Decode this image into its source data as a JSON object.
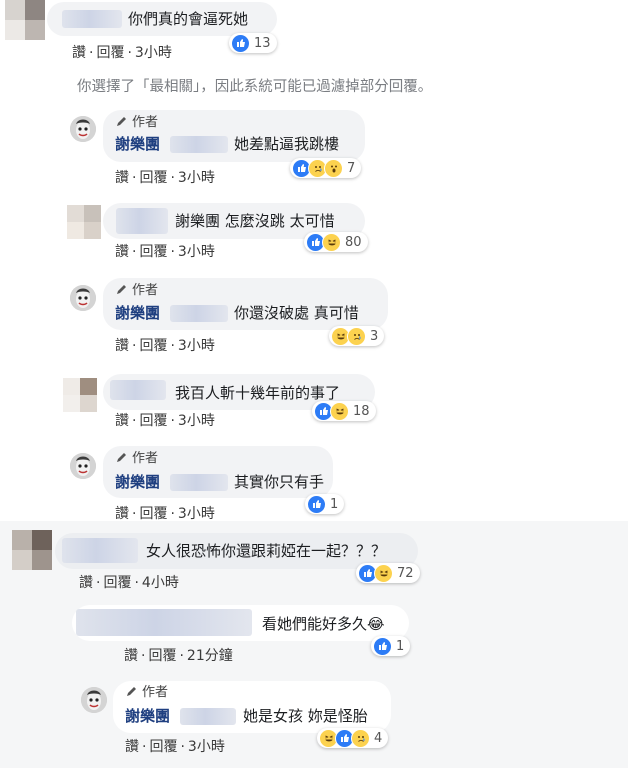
{
  "actions": {
    "like": "讚",
    "reply": "回覆",
    "separator": "·"
  },
  "author_badge": "作者",
  "notice": "你選擇了「最相關」，因此系統可能已過濾掉部分回覆。",
  "colors": {
    "like_blue": "#2d7cf6",
    "emoji_yellow": "#fcd24f",
    "name_blue": "#1f3f80"
  },
  "comments": [
    {
      "text": "你們真的會逼死她",
      "time": "3小時",
      "reactions": [
        "like"
      ],
      "count": "13"
    },
    {
      "author": true,
      "name": "謝樂團",
      "text": "她差點逼我跳樓",
      "time": "3小時",
      "reactions": [
        "like",
        "sad",
        "wow"
      ],
      "count": "7"
    },
    {
      "name": "謝樂團",
      "text": "怎麼沒跳 太可惜",
      "time": "3小時",
      "reactions": [
        "like",
        "haha"
      ],
      "count": "80"
    },
    {
      "author": true,
      "name": "謝樂團",
      "text": "你還沒破處 真可惜",
      "time": "3小時",
      "reactions": [
        "haha",
        "sad"
      ],
      "count": "3"
    },
    {
      "text": "我百人斬十幾年前的事了",
      "time": "3小時",
      "reactions": [
        "like",
        "haha"
      ],
      "count": "18"
    },
    {
      "author": true,
      "name": "謝樂團",
      "text": "其實你只有手",
      "time": "3小時",
      "reactions": [
        "like"
      ],
      "count": "1"
    },
    {
      "text": "女人很恐怖你還跟莉婭在一起？？？",
      "time": "4小時",
      "reactions": [
        "like",
        "haha"
      ],
      "count": "72"
    },
    {
      "text": "看她們能好多久",
      "emoji": "😂",
      "time": "21分鐘",
      "reactions": [
        "like"
      ],
      "count": "1"
    },
    {
      "author": true,
      "name": "謝樂團",
      "text": "她是女孩 妳是怪胎",
      "time": "3小時",
      "reactions": [
        "haha",
        "like",
        "sad"
      ],
      "count": "4"
    }
  ]
}
